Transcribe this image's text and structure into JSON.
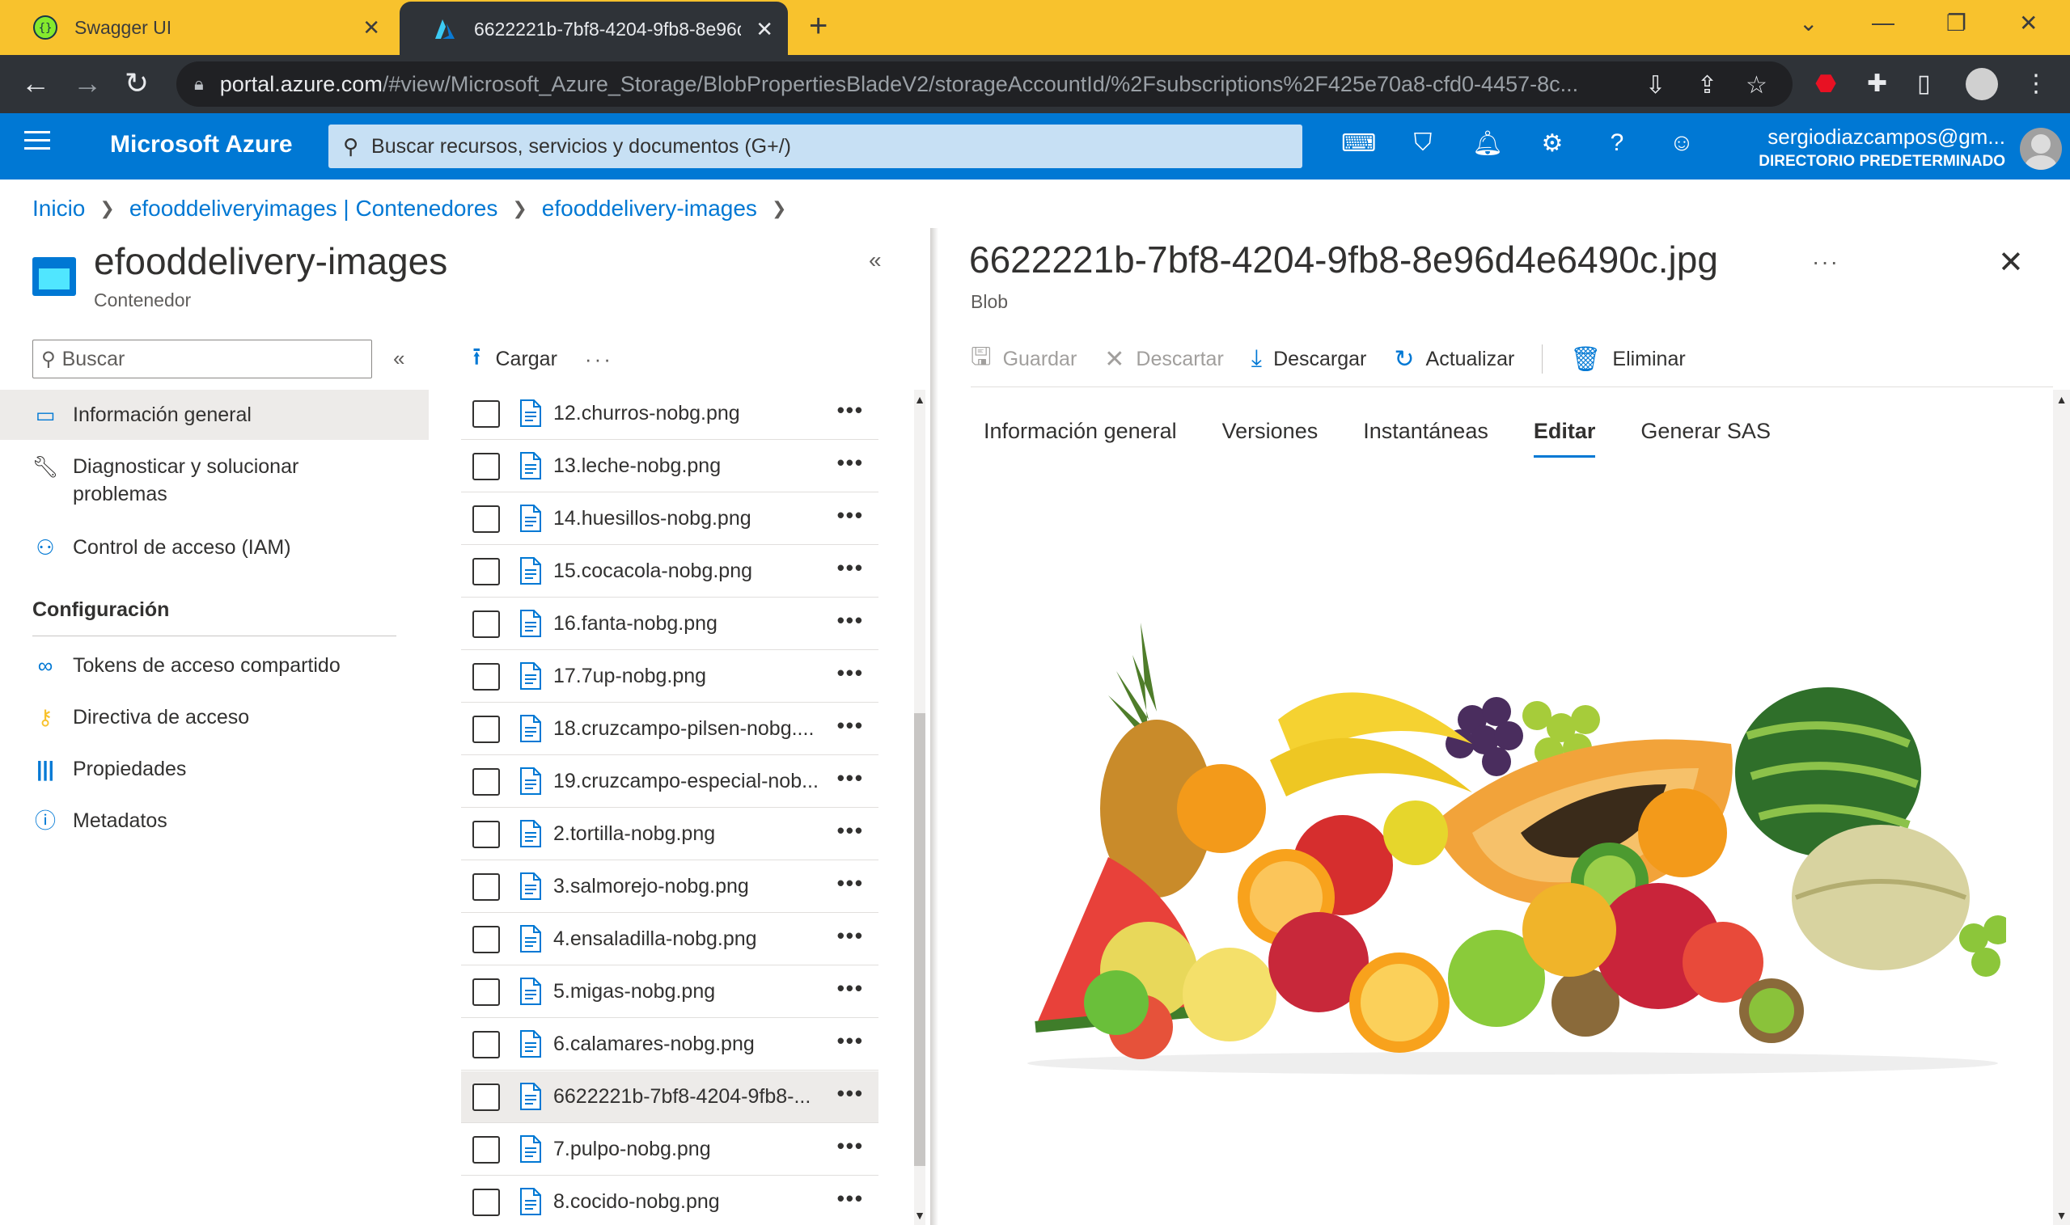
{
  "browser": {
    "tabs": [
      {
        "title": "Swagger UI",
        "active": false
      },
      {
        "title": "6622221b-7bf8-4204-9fb8-8e96d",
        "active": true
      }
    ],
    "url_host": "portal.azure.com",
    "url_path": "/#view/Microsoft_Azure_Storage/BlobPropertiesBladeV2/storageAccountId/%2Fsubscriptions%2F425e70a8-cfd0-4457-8c..."
  },
  "azure": {
    "brand": "Microsoft Azure",
    "search_placeholder": "Buscar recursos, servicios y documentos (G+/)",
    "account_email": "sergiodiazcampos@gm...",
    "account_directory": "DIRECTORIO PREDETERMINADO"
  },
  "breadcrumb": [
    "Inicio",
    "efooddeliveryimages | Contenedores",
    "efooddelivery-images"
  ],
  "left_blade": {
    "title": "efooddelivery-images",
    "subtitle": "Contenedor",
    "search_placeholder": "Buscar",
    "menu": [
      {
        "label": "Información general",
        "icon": "overview-icon",
        "selected": true
      },
      {
        "label": "Diagnosticar y solucionar problemas",
        "icon": "wrench-icon",
        "selected": false
      },
      {
        "label": "Control de acceso (IAM)",
        "icon": "people-icon",
        "selected": false
      }
    ],
    "section": "Configuración",
    "config_menu": [
      {
        "label": "Tokens de acceso compartido",
        "icon": "link-icon"
      },
      {
        "label": "Directiva de acceso",
        "icon": "key-icon"
      },
      {
        "label": "Propiedades",
        "icon": "properties-icon"
      },
      {
        "label": "Metadatos",
        "icon": "info-icon"
      }
    ]
  },
  "file_list": {
    "upload_label": "Cargar",
    "files": [
      {
        "name": "12.churros-nobg.png",
        "selected": false
      },
      {
        "name": "13.leche-nobg.png",
        "selected": false
      },
      {
        "name": "14.huesillos-nobg.png",
        "selected": false
      },
      {
        "name": "15.cocacola-nobg.png",
        "selected": false
      },
      {
        "name": "16.fanta-nobg.png",
        "selected": false
      },
      {
        "name": "17.7up-nobg.png",
        "selected": false
      },
      {
        "name": "18.cruzcampo-pilsen-nobg....",
        "selected": false
      },
      {
        "name": "19.cruzcampo-especial-nob...",
        "selected": false
      },
      {
        "name": "2.tortilla-nobg.png",
        "selected": false
      },
      {
        "name": "3.salmorejo-nobg.png",
        "selected": false
      },
      {
        "name": "4.ensaladilla-nobg.png",
        "selected": false
      },
      {
        "name": "5.migas-nobg.png",
        "selected": false
      },
      {
        "name": "6.calamares-nobg.png",
        "selected": false
      },
      {
        "name": "6622221b-7bf8-4204-9fb8-...",
        "selected": true
      },
      {
        "name": "7.pulpo-nobg.png",
        "selected": false
      },
      {
        "name": "8.cocido-nobg.png",
        "selected": false
      },
      {
        "name": "",
        "selected": false
      }
    ]
  },
  "right_blade": {
    "title": "6622221b-7bf8-4204-9fb8-8e96d4e6490c.jpg",
    "subtitle": "Blob",
    "toolbar": {
      "save": "Guardar",
      "discard": "Descartar",
      "download": "Descargar",
      "refresh": "Actualizar",
      "delete": "Eliminar"
    },
    "tabs": [
      "Información general",
      "Versiones",
      "Instantáneas",
      "Editar",
      "Generar SAS"
    ],
    "active_tab": "Editar"
  },
  "colors": {
    "azure_blue": "#0078d4",
    "tab_bar": "#f8c22d",
    "chrome_dark": "#2f3338"
  }
}
